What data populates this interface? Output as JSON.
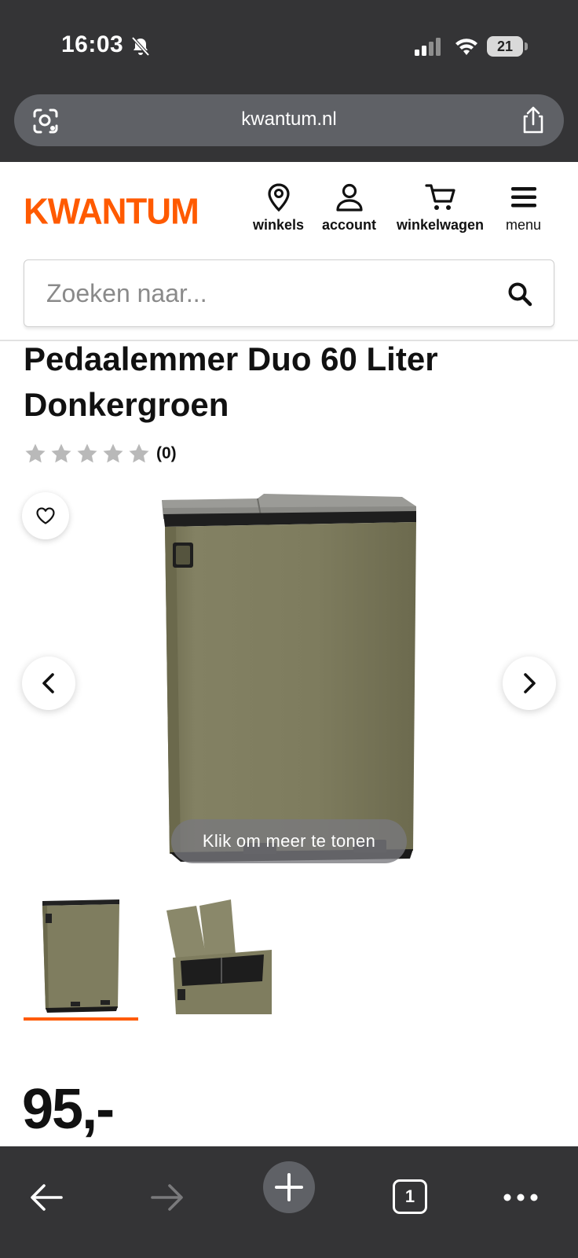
{
  "status_bar": {
    "time": "16:03",
    "battery": "21",
    "icons": [
      "bell-slash-icon",
      "signal-icon",
      "wifi-icon",
      "battery-icon"
    ]
  },
  "browser": {
    "url": "kwantum.nl",
    "icons": [
      "visual-search-icon",
      "share-icon"
    ]
  },
  "header": {
    "logo": "KWANTUM",
    "brand_color": "#ff5a00",
    "nav": [
      {
        "label": "winkels",
        "icon": "location-pin-icon"
      },
      {
        "label": "account",
        "icon": "user-icon"
      },
      {
        "label": "winkelwagen",
        "icon": "cart-icon"
      },
      {
        "label": "menu",
        "icon": "hamburger-icon"
      }
    ]
  },
  "search": {
    "placeholder": "Zoeken naar...",
    "icon": "search-icon"
  },
  "product": {
    "title": "Pedaalemmer Duo 60 Liter Donkergroen",
    "rating": 0,
    "rating_max": 5,
    "review_count": "(0)",
    "gallery_overlay": "Klik om meer te tonen",
    "thumbnails": [
      "thumbnail-closed",
      "thumbnail-open"
    ],
    "selected_thumbnail": 1,
    "price": "95,-",
    "product_color": "#7d7b5c"
  },
  "toolbar": {
    "tab_count": "1",
    "icons": [
      "back-arrow-icon",
      "forward-arrow-icon",
      "new-tab-plus-icon",
      "tabs-icon",
      "more-dots-icon"
    ]
  }
}
